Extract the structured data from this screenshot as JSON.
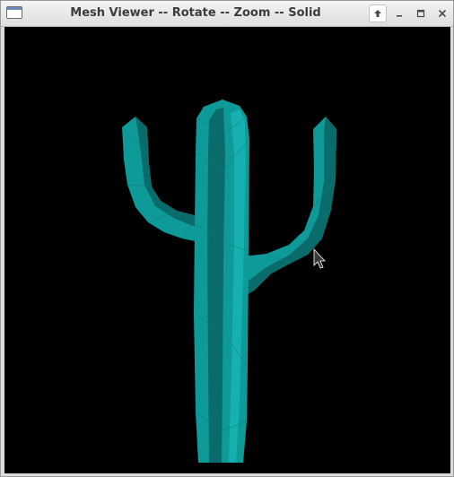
{
  "window": {
    "title": "Mesh Viewer -- Rotate -- Zoom -- Solid",
    "icons": [
      "window-menu-icon",
      "shade-icon",
      "minimize-icon",
      "maximize-icon",
      "close-icon"
    ]
  },
  "viewport": {
    "background_color": "#000000",
    "mesh_color": "#0f9a9a",
    "mesh_shadow_color": "#0a6b6b",
    "mesh_highlight_color": "#16b0b0",
    "cursor_icon": "mouse-pointer-icon"
  }
}
